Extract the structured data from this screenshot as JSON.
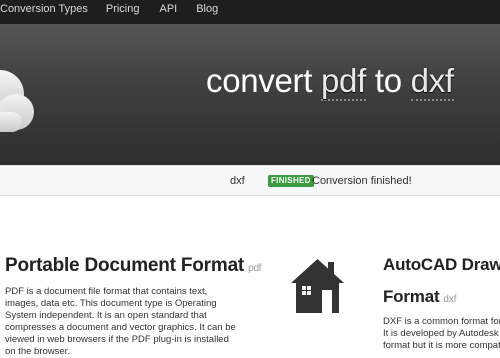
{
  "nav": {
    "items": [
      "Conversion Types",
      "Pricing",
      "API",
      "Blog"
    ]
  },
  "hero": {
    "title_prefix": "convert",
    "title_from": "pdf",
    "title_mid": "to",
    "title_to": "dxf"
  },
  "status": {
    "file_name": "dxf",
    "badge": "FINISHED",
    "message": "Conversion finished!"
  },
  "formats": {
    "left": {
      "title": "Portable Document Format",
      "ext": "pdf",
      "description": "PDF is a document file format that contains text, images, data etc. This document type is Operating System independent. It is an open standard that compresses a document and vector graphics. It can be viewed in web browsers if the PDF plug-in is installed on the browser."
    },
    "right": {
      "title_line1": "AutoCAD Drawi",
      "title_line2": "Format",
      "ext": "dxf",
      "description_lines": [
        "DXF is a common format for C",
        "It is developed by Autodesk a",
        "format but it is more compatib"
      ]
    }
  },
  "icons": {
    "hero": "cloud-icon",
    "target_format": "house-icon"
  },
  "colors": {
    "nav_bg": "#1e1e1e",
    "badge_green": "#3d9a40",
    "hero_dark": "#3f3f3f"
  }
}
